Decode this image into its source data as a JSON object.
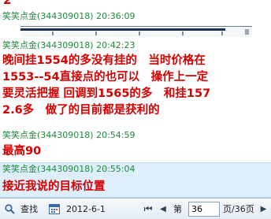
{
  "history": {
    "top_partial_text": "2",
    "messages": [
      {
        "sender": "笑笑点金(344309018)",
        "time": "20:36:09",
        "lines": []
      },
      {
        "sender": "笑笑点金(344309018)",
        "time": "20:42:23",
        "lines": [
          "晚间挂1554的多没有挂的　当时价格在",
          "1553--54直接点的也可以　操作上一定",
          "要灵活把握 回调到1565的多　和挂157",
          "2.6多　做了的目前都是获利的"
        ]
      },
      {
        "sender": "笑笑点金(344309018)",
        "time": "20:54:59",
        "lines": [
          "最高90"
        ]
      },
      {
        "sender": "笑笑点金(344309018)",
        "time": "20:55:04",
        "lines": [
          "接近我说的目标位置"
        ]
      }
    ]
  },
  "footer": {
    "search_label": "查找",
    "date": "2012-6-1",
    "first_icon": "⏮",
    "prev_icon": "◀",
    "page_prefix": "第",
    "page_value": "36",
    "page_suffix": "页/36页",
    "next_icon": "▶"
  },
  "colors": {
    "sender": "#1f8a3c",
    "message": "#d40000",
    "selected_bg": "#ddeffb"
  }
}
